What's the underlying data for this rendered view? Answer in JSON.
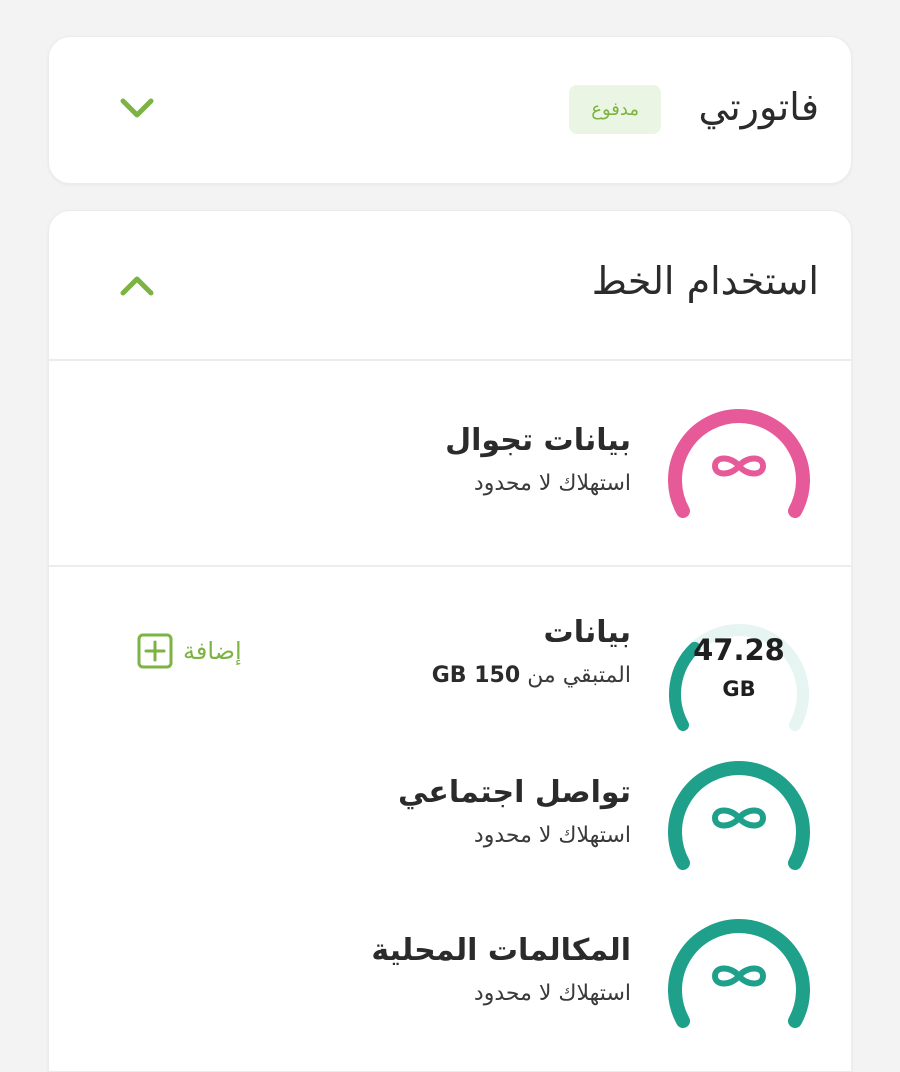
{
  "bill": {
    "title": "فاتورتي",
    "status_badge": "مدفوع",
    "expanded": false
  },
  "line_usage": {
    "title": "استخدام الخط",
    "expanded": true,
    "items": [
      {
        "title": "بيانات تجوال",
        "subtitle": "استهلاك لا محدود",
        "gauge_color": "#e75a99",
        "gauge_icon": "infinity-icon"
      },
      {
        "title": "بيانات",
        "remaining_prefix": "المتبقي من",
        "remaining_total": "150 GB",
        "value": "47.28",
        "unit": "GB",
        "remaining_fraction": 0.3152,
        "gauge_color": "#1fa08a",
        "gauge_track_color": "#e6f4f2",
        "add_label": "إضافة",
        "add_icon": "plus-square-icon"
      },
      {
        "title": "تواصل اجتماعي",
        "subtitle": "استهلاك لا محدود",
        "gauge_color": "#1fa08a",
        "gauge_icon": "infinity-icon"
      },
      {
        "title": "المكالمات المحلية",
        "subtitle": "استهلاك لا محدود",
        "gauge_color": "#1fa08a",
        "gauge_icon": "infinity-icon"
      }
    ]
  },
  "colors": {
    "accent_green": "#7cb342",
    "badge_bg": "#eaf5e3"
  }
}
